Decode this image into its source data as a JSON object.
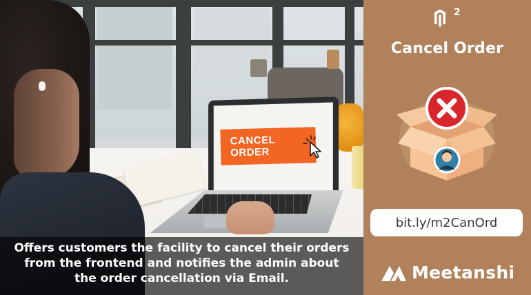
{
  "hero": {
    "button_label": "CANCEL ORDER",
    "caption_lines": [
      "Offers customers the facility to cancel their orders",
      "from the frontend and notifies the admin about",
      "the order cancellation via Email."
    ]
  },
  "panel": {
    "platform_icon": "magento-2-icon",
    "platform_version": "2",
    "title": "Cancel Order",
    "illustration": "box-with-cancel-icon",
    "short_link": "bit.ly/m2CanOrd",
    "brand_name": "Meetanshi",
    "brand_icon": "meetanshi-logo-icon"
  },
  "colors": {
    "panel_bg": "#b0815a",
    "accent_orange": "#f26522",
    "cancel_red": "#d9262c",
    "box_color": "#f3bd8e"
  }
}
